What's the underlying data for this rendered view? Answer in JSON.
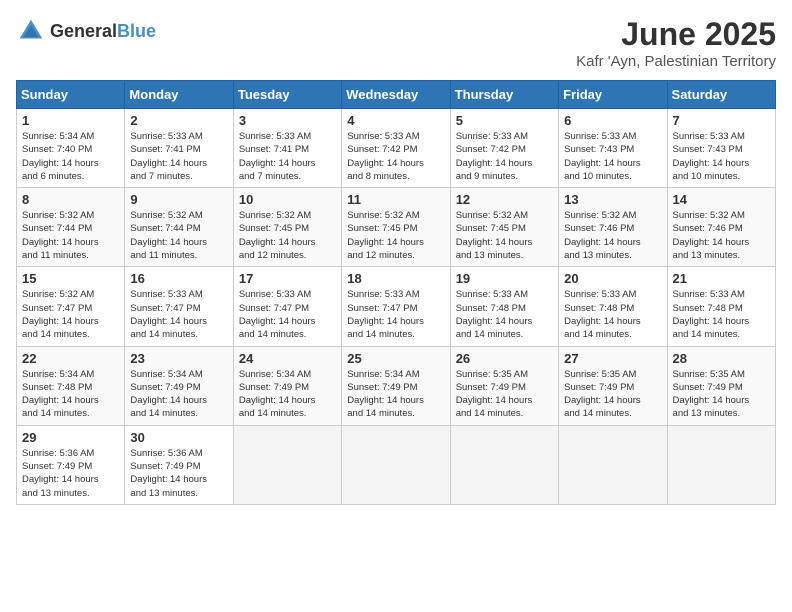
{
  "header": {
    "logo_general": "General",
    "logo_blue": "Blue",
    "title": "June 2025",
    "subtitle": "Kafr 'Ayn, Palestinian Territory"
  },
  "columns": [
    "Sunday",
    "Monday",
    "Tuesday",
    "Wednesday",
    "Thursday",
    "Friday",
    "Saturday"
  ],
  "weeks": [
    [
      {
        "day": "1",
        "info": "Sunrise: 5:34 AM\nSunset: 7:40 PM\nDaylight: 14 hours\nand 6 minutes."
      },
      {
        "day": "2",
        "info": "Sunrise: 5:33 AM\nSunset: 7:41 PM\nDaylight: 14 hours\nand 7 minutes."
      },
      {
        "day": "3",
        "info": "Sunrise: 5:33 AM\nSunset: 7:41 PM\nDaylight: 14 hours\nand 7 minutes."
      },
      {
        "day": "4",
        "info": "Sunrise: 5:33 AM\nSunset: 7:42 PM\nDaylight: 14 hours\nand 8 minutes."
      },
      {
        "day": "5",
        "info": "Sunrise: 5:33 AM\nSunset: 7:42 PM\nDaylight: 14 hours\nand 9 minutes."
      },
      {
        "day": "6",
        "info": "Sunrise: 5:33 AM\nSunset: 7:43 PM\nDaylight: 14 hours\nand 10 minutes."
      },
      {
        "day": "7",
        "info": "Sunrise: 5:33 AM\nSunset: 7:43 PM\nDaylight: 14 hours\nand 10 minutes."
      }
    ],
    [
      {
        "day": "8",
        "info": "Sunrise: 5:32 AM\nSunset: 7:44 PM\nDaylight: 14 hours\nand 11 minutes."
      },
      {
        "day": "9",
        "info": "Sunrise: 5:32 AM\nSunset: 7:44 PM\nDaylight: 14 hours\nand 11 minutes."
      },
      {
        "day": "10",
        "info": "Sunrise: 5:32 AM\nSunset: 7:45 PM\nDaylight: 14 hours\nand 12 minutes."
      },
      {
        "day": "11",
        "info": "Sunrise: 5:32 AM\nSunset: 7:45 PM\nDaylight: 14 hours\nand 12 minutes."
      },
      {
        "day": "12",
        "info": "Sunrise: 5:32 AM\nSunset: 7:45 PM\nDaylight: 14 hours\nand 13 minutes."
      },
      {
        "day": "13",
        "info": "Sunrise: 5:32 AM\nSunset: 7:46 PM\nDaylight: 14 hours\nand 13 minutes."
      },
      {
        "day": "14",
        "info": "Sunrise: 5:32 AM\nSunset: 7:46 PM\nDaylight: 14 hours\nand 13 minutes."
      }
    ],
    [
      {
        "day": "15",
        "info": "Sunrise: 5:32 AM\nSunset: 7:47 PM\nDaylight: 14 hours\nand 14 minutes."
      },
      {
        "day": "16",
        "info": "Sunrise: 5:33 AM\nSunset: 7:47 PM\nDaylight: 14 hours\nand 14 minutes."
      },
      {
        "day": "17",
        "info": "Sunrise: 5:33 AM\nSunset: 7:47 PM\nDaylight: 14 hours\nand 14 minutes."
      },
      {
        "day": "18",
        "info": "Sunrise: 5:33 AM\nSunset: 7:47 PM\nDaylight: 14 hours\nand 14 minutes."
      },
      {
        "day": "19",
        "info": "Sunrise: 5:33 AM\nSunset: 7:48 PM\nDaylight: 14 hours\nand 14 minutes."
      },
      {
        "day": "20",
        "info": "Sunrise: 5:33 AM\nSunset: 7:48 PM\nDaylight: 14 hours\nand 14 minutes."
      },
      {
        "day": "21",
        "info": "Sunrise: 5:33 AM\nSunset: 7:48 PM\nDaylight: 14 hours\nand 14 minutes."
      }
    ],
    [
      {
        "day": "22",
        "info": "Sunrise: 5:34 AM\nSunset: 7:48 PM\nDaylight: 14 hours\nand 14 minutes."
      },
      {
        "day": "23",
        "info": "Sunrise: 5:34 AM\nSunset: 7:49 PM\nDaylight: 14 hours\nand 14 minutes."
      },
      {
        "day": "24",
        "info": "Sunrise: 5:34 AM\nSunset: 7:49 PM\nDaylight: 14 hours\nand 14 minutes."
      },
      {
        "day": "25",
        "info": "Sunrise: 5:34 AM\nSunset: 7:49 PM\nDaylight: 14 hours\nand 14 minutes."
      },
      {
        "day": "26",
        "info": "Sunrise: 5:35 AM\nSunset: 7:49 PM\nDaylight: 14 hours\nand 14 minutes."
      },
      {
        "day": "27",
        "info": "Sunrise: 5:35 AM\nSunset: 7:49 PM\nDaylight: 14 hours\nand 14 minutes."
      },
      {
        "day": "28",
        "info": "Sunrise: 5:35 AM\nSunset: 7:49 PM\nDaylight: 14 hours\nand 13 minutes."
      }
    ],
    [
      {
        "day": "29",
        "info": "Sunrise: 5:36 AM\nSunset: 7:49 PM\nDaylight: 14 hours\nand 13 minutes."
      },
      {
        "day": "30",
        "info": "Sunrise: 5:36 AM\nSunset: 7:49 PM\nDaylight: 14 hours\nand 13 minutes."
      },
      {
        "day": "",
        "info": ""
      },
      {
        "day": "",
        "info": ""
      },
      {
        "day": "",
        "info": ""
      },
      {
        "day": "",
        "info": ""
      },
      {
        "day": "",
        "info": ""
      }
    ]
  ]
}
